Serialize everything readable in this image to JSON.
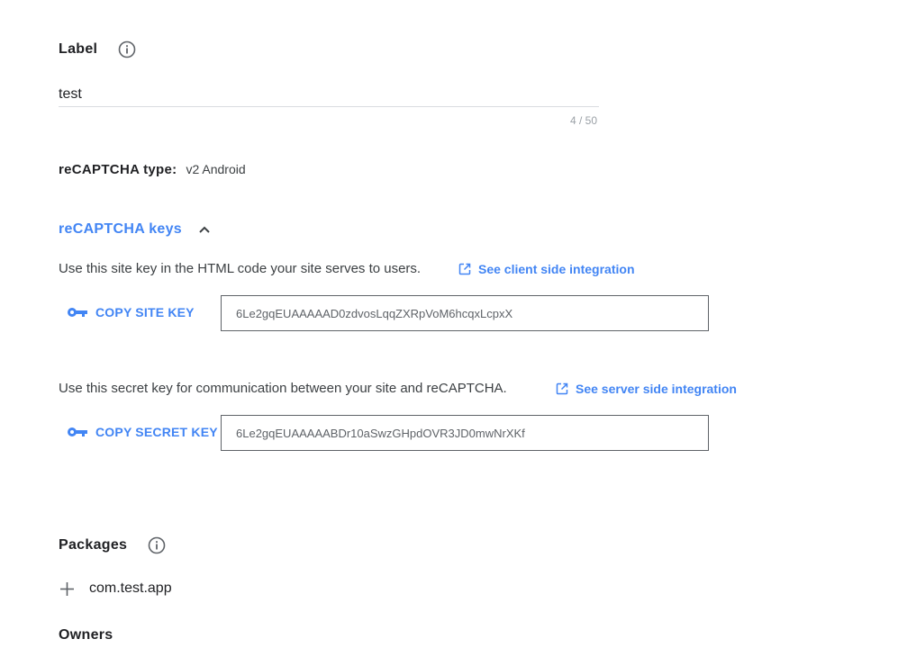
{
  "label_section": {
    "title": "Label",
    "value": "test",
    "counter": "4 / 50"
  },
  "recaptcha_type": {
    "label": "reCAPTCHA type:",
    "value": "v2 Android"
  },
  "keys_section": {
    "title": "reCAPTCHA keys",
    "site_description": "Use this site key in the HTML code your site serves to users.",
    "site_link": "See client side integration",
    "copy_site_key": "COPY SITE KEY",
    "site_key": "6Le2gqEUAAAAAD0zdvosLqqZXRpVoM6hcqxLcpxX",
    "secret_description": "Use this secret key for communication between your site and reCAPTCHA.",
    "secret_link": "See server side integration",
    "copy_secret_key": "COPY SECRET KEY",
    "secret_key": "6Le2gqEUAAAAABDr10aSwzGHpdOVR3JD0mwNrXKf"
  },
  "packages_section": {
    "title": "Packages",
    "items": [
      "com.test.app"
    ]
  },
  "owners_section": {
    "title": "Owners"
  },
  "colors": {
    "accent": "#4285f4",
    "text": "#3c4043",
    "heading": "#202124"
  }
}
